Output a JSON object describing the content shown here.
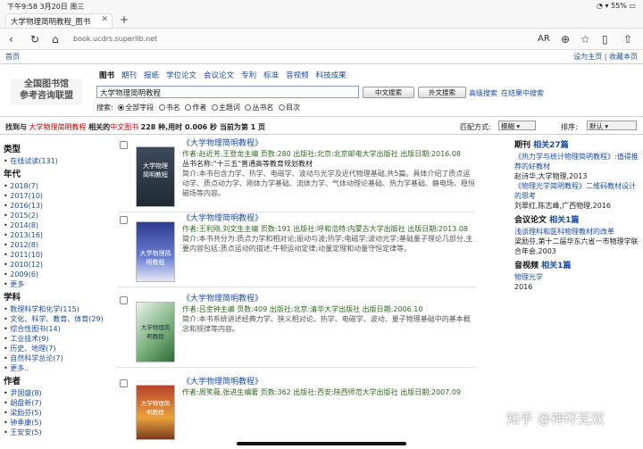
{
  "status": {
    "time": "下午9:58",
    "date": "3月20日 周三",
    "battery": "55%"
  },
  "browser": {
    "tab_title": "大学物理简明教程_图书",
    "url": "book.ucdrs.superlib.net",
    "reader": "AR"
  },
  "site": {
    "home": "首页",
    "right": "设为主页 | 收藏本页"
  },
  "logo": {
    "line1": "全国图书馆",
    "line2": "参考咨询联盟"
  },
  "channels": [
    "图书",
    "期刊",
    "报纸",
    "学位论文",
    "会议论文",
    "专利",
    "标准",
    "音视频",
    "科技成果"
  ],
  "search": {
    "query": "大学物理简明教程",
    "btn_cn": "中文搜索",
    "btn_foreign": "外文搜索",
    "advanced": "高级搜索",
    "in_results": "在结果中搜索",
    "scope_label": "搜索:",
    "scopes": [
      "全部字段",
      "书名",
      "作者",
      "主题词",
      "丛书名",
      "目次"
    ]
  },
  "summary": {
    "prefix": "找到与",
    "kw": "大学物理简明教程",
    "mid": "相关的",
    "type": "中文图书",
    "tail": "228 种,用时 0.006 秒 当前为第 1 页",
    "match_label": "匹配方式:",
    "match_val": "模糊",
    "sort_label": "排序:",
    "sort_val": "默认"
  },
  "facets": {
    "type_title": "类型",
    "type_items": [
      "在线试读(131)"
    ],
    "year_title": "年代",
    "year_items": [
      "2018(7)",
      "2017(10)",
      "2016(13)",
      "2015(2)",
      "2014(8)",
      "2013(16)",
      "2012(8)",
      "2011(10)",
      "2010(12)",
      "2009(6)",
      "更多"
    ],
    "subject_title": "学科",
    "subject_items": [
      "数理科学和化学(115)",
      "文化、科学、教育、体育(29)",
      "综合性图书(14)",
      "工业技术(9)",
      "历史、地理(7)",
      "自然科学总论(7)",
      "更多.."
    ],
    "author_title": "作者",
    "author_items": [
      "尹国盛(8)",
      "胡盘新(7)",
      "梁励芬(5)",
      "钟季康(5)",
      "王安安(5)"
    ]
  },
  "results": [
    {
      "title": "《大学物理简明教程》",
      "author": "作者:赵近芳,王登龙主编 页数:280 出版社:北京:北京邮电大学出版社 出版日期:2016.08",
      "series": "丛书名称:\"十三五\"普通高等教育规划教材",
      "desc": "简介:本书包含力学、热学、电磁学、波动与光学及近代物理基础,共5篇。具体介绍了质点运动学、质点动力学、刚体力学基础、流体力学、气体动理论基础、热力学基础、静电场、稳恒磁场等内容。"
    },
    {
      "title": "《大学物理简明教程》",
      "author": "作者:王利刚,刘文生主编 页数:191 出版社:呼和浩特:内蒙古大学出版社 出版日期:2013.08",
      "series": "",
      "desc": "简介:本书共分为:质点力学和相对论;振动与波;热学;电磁学;波动光学;基础量子理论几部分,主要内容包括:质点运动的描述;牛顿运动定律;动量定理和动量守恒定律等。"
    },
    {
      "title": "《大学物理简明教程》",
      "author": "作者:吕金钟主编 页数:409 出版社:北京:清华大学出版社 出版日期:2006.10",
      "series": "",
      "desc": "简介:本书系统讲述经典力学、狭义相对论、热学、电磁学、波动、量子物理基础中的基本概念和规律等内容。"
    },
    {
      "title": "《大学物理简明教程》",
      "author": "作者:周笑薇,张进生编著 页数:362 出版社:西安:陕西师范大学出版社 出版日期:2007.09",
      "series": "",
      "desc": ""
    }
  ],
  "covers": [
    "大学物理 简明教程",
    "大学物理简明教程",
    "大学物理简明教程",
    "大学物理简明教程"
  ],
  "right_panel": {
    "journal_title": "期刊",
    "journal_count": "相关27篇",
    "journal_items": [
      {
        "t": "《热力学与统计物理简明教程》:值得推荐的好教材",
        "m": "赵诗华,大学物理,2013"
      },
      {
        "t": "《物理光学简明教程》二维码教材设计的思考",
        "m": "刘翠红,陈志峰,广西物理,2016"
      }
    ],
    "conf_title": "会议论文",
    "conf_count": "相关1篇",
    "conf_items": [
      {
        "t": "浅谈理科和医科物理教材的改革",
        "m": "梁励芬,第十二届华东六省一市物理学联合年会,2003"
      }
    ],
    "video_title": "音视频",
    "video_count": "相关1篇",
    "video_items": [
      {
        "t": "物理光学",
        "m": "2016"
      }
    ]
  },
  "watermark": "知乎 @神环无双"
}
